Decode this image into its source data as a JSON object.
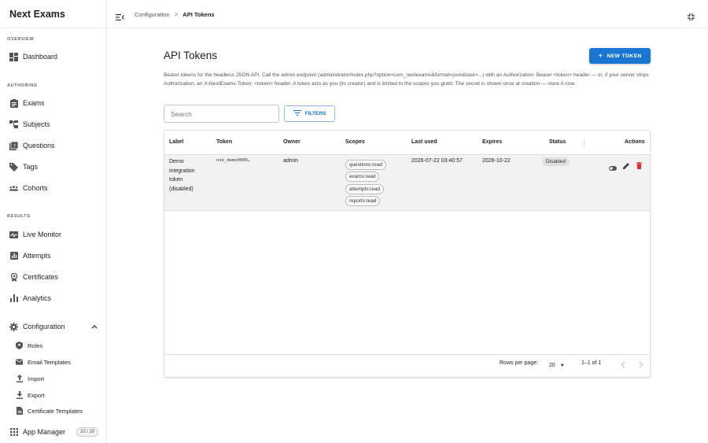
{
  "app": {
    "title": "Next Exams"
  },
  "sidebar": {
    "sections": {
      "overview": "OVERVIEW",
      "authoring": "AUTHORING",
      "results": "RESULTS"
    },
    "items": {
      "dashboard": "Dashboard",
      "exams": "Exams",
      "subjects": "Subjects",
      "questions": "Questions",
      "tags": "Tags",
      "cohorts": "Cohorts",
      "live_monitor": "Live Monitor",
      "attempts": "Attempts",
      "certificates": "Certificates",
      "analytics": "Analytics",
      "configuration": "Configuration",
      "app_manager": "App Manager"
    },
    "config_sub": {
      "roles": "Roles",
      "email_templates": "Email Templates",
      "import": "Import",
      "export": "Export",
      "certificate_templates": "Certificate Templates"
    },
    "app_manager_badge": "20 / 20"
  },
  "breadcrumb": {
    "parent": "Configuration",
    "separator": ">",
    "current": "API Tokens"
  },
  "page": {
    "title": "API Tokens",
    "new_button": "NEW TOKEN",
    "description": "Bearer tokens for the headless JSON API. Call the admin endpoint (administrator/index.php?option=com_nextexams&format=json&task=...) with an Authorization: Bearer <token> header — or, if your server strips Authorization, an X-NextExams-Token: <token> header. A token acts as you (its creator) and is limited to the scopes you grant. The secret is shown once at creation — store it now.",
    "search_placeholder": "Search",
    "filters_label": "FILTERS"
  },
  "table": {
    "columns": {
      "label": "Label",
      "token": "Token",
      "owner": "Owner",
      "scopes": "Scopes",
      "last_used": "Last used",
      "expires": "Expires",
      "status": "Status",
      "actions": "Actions"
    },
    "rows": [
      {
        "label_lines": [
          "Demo",
          "integration",
          "token",
          "(disabled)"
        ],
        "token": "nxk_demo0000…",
        "owner": "admin",
        "scopes": [
          "questions:read",
          "exams:read",
          "attempts:read",
          "reports:read"
        ],
        "last_used": "2026-07-22 03:40:57",
        "expires": "2026-10-22",
        "status": "Disabled"
      }
    ],
    "footer": {
      "rows_per_page_label": "Rows per page:",
      "rows_per_page": "20",
      "range": "1–1 of 1"
    }
  },
  "colors": {
    "primary": "#1976d2",
    "delete": "#d32f2f",
    "row_bg": "#f2f2f2"
  }
}
